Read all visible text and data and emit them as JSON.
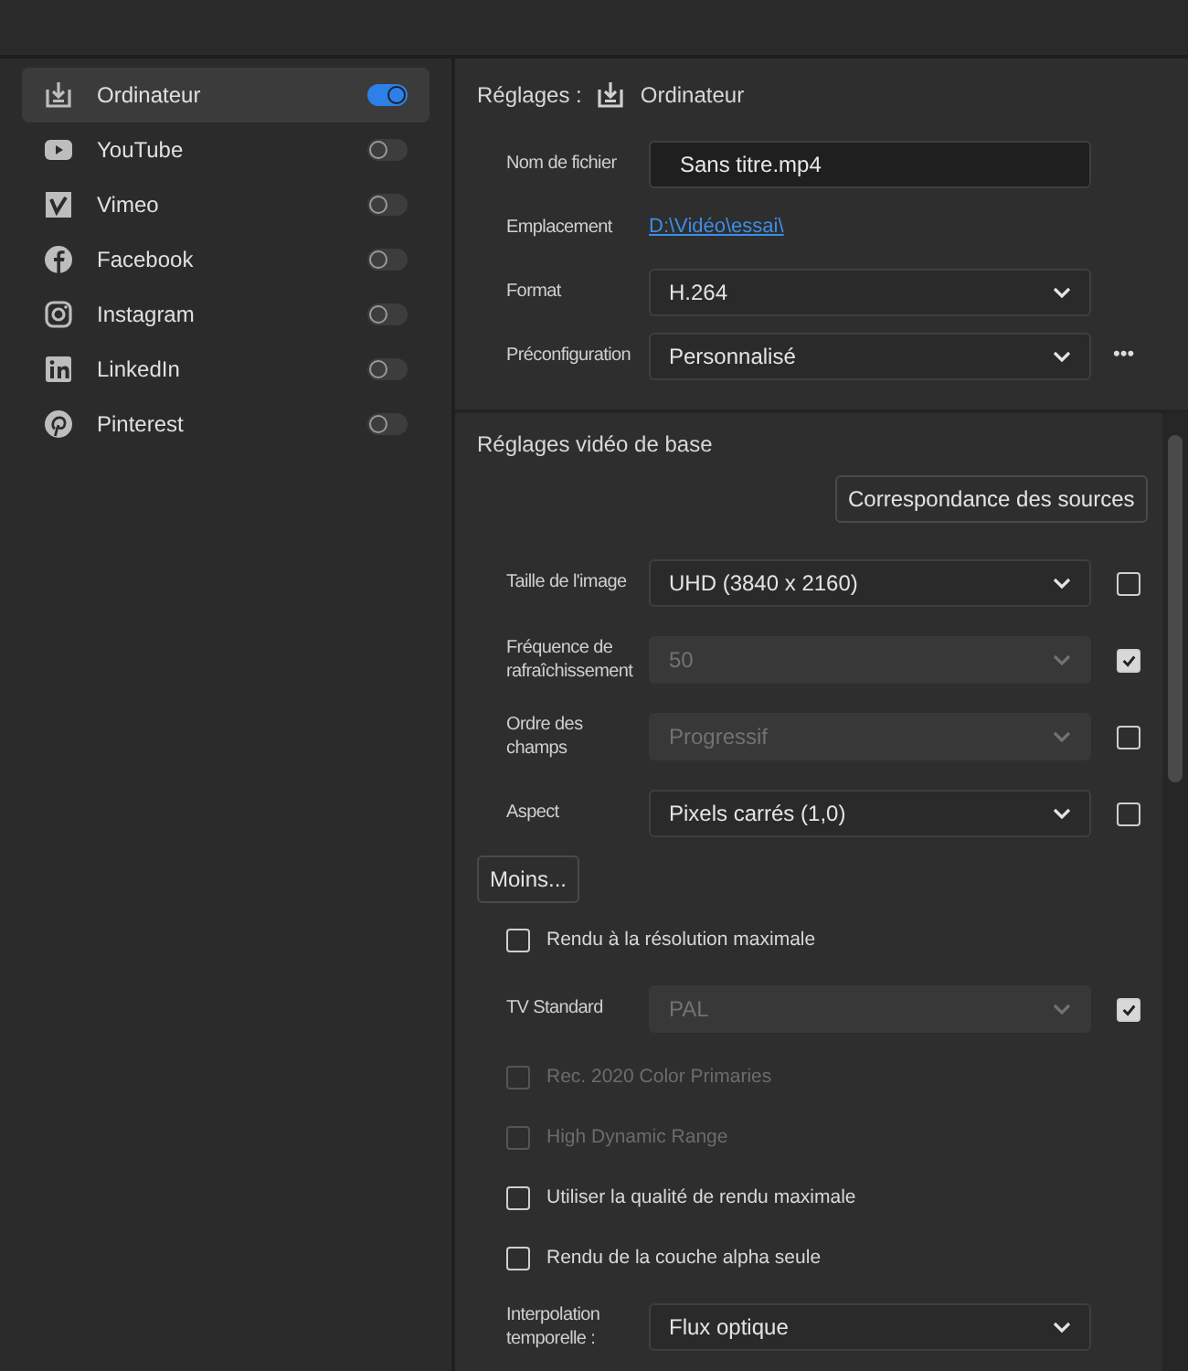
{
  "destinations": [
    {
      "label": "Ordinateur",
      "selected": true,
      "on": true
    },
    {
      "label": "YouTube",
      "selected": false,
      "on": false
    },
    {
      "label": "Vimeo",
      "selected": false,
      "on": false
    },
    {
      "label": "Facebook",
      "selected": false,
      "on": false
    },
    {
      "label": "Instagram",
      "selected": false,
      "on": false
    },
    {
      "label": "LinkedIn",
      "selected": false,
      "on": false
    },
    {
      "label": "Pinterest",
      "selected": false,
      "on": false
    }
  ],
  "settings": {
    "title": "Réglages :",
    "target": "Ordinateur",
    "fields": [
      {
        "kind": "input",
        "label": "Nom de fichier",
        "value": "Sans titre.mp4"
      },
      {
        "kind": "link",
        "label": "Emplacement",
        "value": "D:\\Vidéo\\essai\\"
      },
      {
        "kind": "select",
        "label": "Format",
        "value": "H.264"
      },
      {
        "kind": "select",
        "label": "Préconfiguration",
        "value": "Personnalisé",
        "more": "•••"
      }
    ]
  },
  "video": {
    "title": "Réglages vidéo de base",
    "match_button": "Correspondance des sources",
    "rows": [
      {
        "kind": "select",
        "label": "Taille de l'image",
        "value": "UHD (3840 x 2160)",
        "disabled": false,
        "checked": false
      },
      {
        "kind": "select",
        "label": "Fréquence de rafraîchissement",
        "value": "50",
        "disabled": true,
        "checked": true
      },
      {
        "kind": "select",
        "label": "Ordre des champs",
        "value": "Progressif",
        "disabled": true,
        "checked": false
      },
      {
        "kind": "select",
        "label": "Aspect",
        "value": "Pixels carrés (1,0)",
        "disabled": false,
        "checked": false
      },
      {
        "kind": "button",
        "label": "Moins..."
      },
      {
        "kind": "checkbox",
        "label": "Rendu à la résolution maximale",
        "disabled": false,
        "checked": false
      },
      {
        "kind": "select",
        "label": "TV Standard",
        "value": "PAL",
        "disabled": true,
        "checked": true
      },
      {
        "kind": "checkbox",
        "label": "Rec. 2020 Color Primaries",
        "disabled": true,
        "checked": false
      },
      {
        "kind": "checkbox",
        "label": "High Dynamic Range",
        "disabled": true,
        "checked": false
      },
      {
        "kind": "checkbox",
        "label": "Utiliser la qualité de rendu maximale",
        "disabled": false,
        "checked": false
      },
      {
        "kind": "checkbox",
        "label": "Rendu de la couche alpha seule",
        "disabled": false,
        "checked": false
      },
      {
        "kind": "select",
        "label": "Interpolation temporelle :",
        "value": "Flux optique",
        "disabled": false
      }
    ]
  }
}
